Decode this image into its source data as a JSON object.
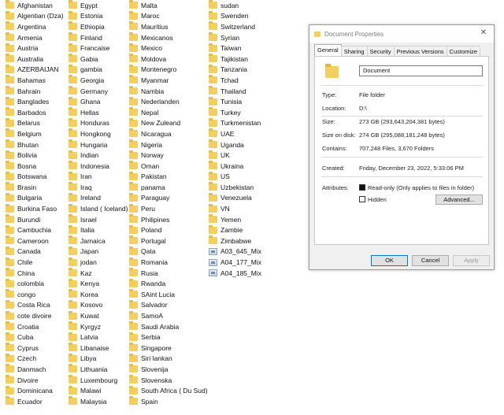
{
  "columns": [
    {
      "items": [
        {
          "label": "Afghanistan"
        },
        {
          "label": "Algentian (Dza)"
        },
        {
          "label": "Argentina"
        },
        {
          "label": "Armenia"
        },
        {
          "label": "Austria"
        },
        {
          "label": "Australia"
        },
        {
          "label": "AZERBAIJAN"
        },
        {
          "label": "Bahamas"
        },
        {
          "label": "Bahrain"
        },
        {
          "label": "Banglades"
        },
        {
          "label": "Barbados"
        },
        {
          "label": "Belarus"
        },
        {
          "label": "Belgium"
        },
        {
          "label": "Bhutan"
        },
        {
          "label": "Bolivia"
        },
        {
          "label": "Bosna"
        },
        {
          "label": "Botswana"
        },
        {
          "label": "Brasin"
        },
        {
          "label": "Bulgaria"
        },
        {
          "label": "Burkina Faso"
        },
        {
          "label": "Burundi"
        },
        {
          "label": "Cambuchia"
        },
        {
          "label": "Cameroon"
        },
        {
          "label": "Canada"
        },
        {
          "label": "Chile"
        },
        {
          "label": "China"
        },
        {
          "label": "colombia"
        },
        {
          "label": "congo"
        },
        {
          "label": "Costa Rica"
        },
        {
          "label": "cote divoire"
        },
        {
          "label": "Croatia"
        },
        {
          "label": "Cuba"
        },
        {
          "label": "Cyprus"
        },
        {
          "label": "Czech"
        },
        {
          "label": "Danmach"
        },
        {
          "label": "Divoire"
        },
        {
          "label": "Dominicana"
        },
        {
          "label": "Ecuador"
        }
      ]
    },
    {
      "items": [
        {
          "label": "Egypt"
        },
        {
          "label": "Estonia"
        },
        {
          "label": "Ethiopia"
        },
        {
          "label": "Finland"
        },
        {
          "label": "Francaise"
        },
        {
          "label": "Gabia"
        },
        {
          "label": "gambia"
        },
        {
          "label": "Georgia"
        },
        {
          "label": "Germany"
        },
        {
          "label": "Ghana"
        },
        {
          "label": "Hellas"
        },
        {
          "label": "Honduras"
        },
        {
          "label": "Hongkong"
        },
        {
          "label": "Hungaria"
        },
        {
          "label": "Indian"
        },
        {
          "label": "Indonesia"
        },
        {
          "label": "Iran"
        },
        {
          "label": "Iraq"
        },
        {
          "label": "Ireland"
        },
        {
          "label": "Island ( Iceland)"
        },
        {
          "label": "Israel"
        },
        {
          "label": "Italia"
        },
        {
          "label": "Jamaica"
        },
        {
          "label": "Japan"
        },
        {
          "label": "jodan"
        },
        {
          "label": "Kaz"
        },
        {
          "label": "Kenya"
        },
        {
          "label": "Korea"
        },
        {
          "label": "Kosovo"
        },
        {
          "label": "Kuwat"
        },
        {
          "label": "Kyrgyz"
        },
        {
          "label": "Latvia"
        },
        {
          "label": "Libanaise"
        },
        {
          "label": "Libya"
        },
        {
          "label": "Lithuania"
        },
        {
          "label": "Luxembourg"
        },
        {
          "label": "Malawi"
        },
        {
          "label": "Malaysia"
        }
      ]
    },
    {
      "items": [
        {
          "label": "Malta"
        },
        {
          "label": "Maroc"
        },
        {
          "label": "Mauritius"
        },
        {
          "label": "Mexicanos"
        },
        {
          "label": "Mexico"
        },
        {
          "label": "Moldova"
        },
        {
          "label": "Montenegro"
        },
        {
          "label": "Myanmar"
        },
        {
          "label": "Nambia"
        },
        {
          "label": "Nederlanden"
        },
        {
          "label": "Nepal"
        },
        {
          "label": "New Zuleand"
        },
        {
          "label": "Nicaragua"
        },
        {
          "label": "Nigeria"
        },
        {
          "label": "Norway"
        },
        {
          "label": "Oman"
        },
        {
          "label": "Pakistan"
        },
        {
          "label": "panama"
        },
        {
          "label": "Paraguay"
        },
        {
          "label": "Peru"
        },
        {
          "label": "Philipines"
        },
        {
          "label": "Poland"
        },
        {
          "label": "Portugal"
        },
        {
          "label": "Qata"
        },
        {
          "label": "Romania"
        },
        {
          "label": "Rusia"
        },
        {
          "label": "Rwanda"
        },
        {
          "label": "SAint Lucia"
        },
        {
          "label": "Salvador"
        },
        {
          "label": "SamoA"
        },
        {
          "label": "Saudi Arabia"
        },
        {
          "label": "Serbia"
        },
        {
          "label": "Singapore"
        },
        {
          "label": "Siri lankan"
        },
        {
          "label": "Slovenija"
        },
        {
          "label": "Slovenska"
        },
        {
          "label": "South Africa ( Du Sud)"
        },
        {
          "label": "Spain"
        }
      ]
    },
    {
      "items": [
        {
          "label": "sudan"
        },
        {
          "label": "Swenden"
        },
        {
          "label": "Switzerland"
        },
        {
          "label": "Syrian"
        },
        {
          "label": "Taiwan"
        },
        {
          "label": "Tajikistan"
        },
        {
          "label": "Tanzania"
        },
        {
          "label": "Tchad"
        },
        {
          "label": "Thailand"
        },
        {
          "label": "Tunisia"
        },
        {
          "label": "Turkey"
        },
        {
          "label": "Turkmenistan"
        },
        {
          "label": "UAE"
        },
        {
          "label": "Uganda"
        },
        {
          "label": "UK"
        },
        {
          "label": "Ukraina"
        },
        {
          "label": "US"
        },
        {
          "label": "Uzbekistan"
        },
        {
          "label": "Venezuela"
        },
        {
          "label": "VN"
        },
        {
          "label": "Yemen"
        },
        {
          "label": "Zambie"
        },
        {
          "label": "Zimbabwe"
        },
        {
          "label": "A03_645_Mix",
          "type": "file"
        },
        {
          "label": "A04_177_Mix",
          "type": "file"
        },
        {
          "label": "A04_185_Mix",
          "type": "file"
        }
      ]
    }
  ],
  "dialog": {
    "title": "Document Properties",
    "close_glyph": "✕",
    "tabs": [
      "General",
      "Sharing",
      "Security",
      "Previous Versions",
      "Customize"
    ],
    "name_value": "Document",
    "type_label": "Type:",
    "type_value": "File folder",
    "location_label": "Location:",
    "location_value": "D:\\",
    "size_label": "Size:",
    "size_value": "273 GB (293,643,204,381 bytes)",
    "sizeondisk_label": "Size on disk:",
    "sizeondisk_value": "274 GB (295,088,181,248 bytes)",
    "contains_label": "Contains:",
    "contains_value": "707,248 Files, 3,670 Folders",
    "created_label": "Created:",
    "created_value": "Friday, December 23, 2022, 5:33:06 PM",
    "attributes_label": "Attributes:",
    "readonly_label": "Read-only (Only applies to files in folder)",
    "hidden_label": "Hidden",
    "advanced_label": "Advanced...",
    "ok_label": "OK",
    "cancel_label": "Cancel",
    "apply_label": "Apply"
  }
}
